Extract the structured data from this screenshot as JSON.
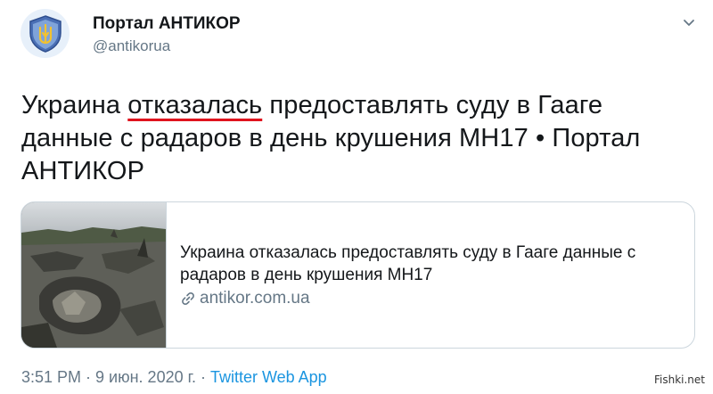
{
  "author": {
    "name": "Портал АНТИКОР",
    "handle": "@antikorua",
    "avatar_icon": "shield-trident-icon"
  },
  "tweet": {
    "text_before": "Украина ",
    "text_underlined": "отказалась",
    "text_after": " предоставлять суду в Гааге данные с радаров в день крушения МН17 • Портал АНТИКОР"
  },
  "card": {
    "title": "Украина отказалась предоставлять суду в Гааге данные с радаров в день крушения МН17",
    "domain": "antikor.com.ua",
    "domain_icon": "link-icon",
    "image": "crash-wreckage-photo"
  },
  "meta": {
    "time": "3:51 PM",
    "sep1": " · ",
    "date": "9 июн. 2020 г.",
    "sep2": " · ",
    "app": "Twitter Web App"
  },
  "watermark": "Fishki.net",
  "colors": {
    "link": "#1b95e0",
    "secondary": "#657786",
    "underline": "#e0141e"
  }
}
